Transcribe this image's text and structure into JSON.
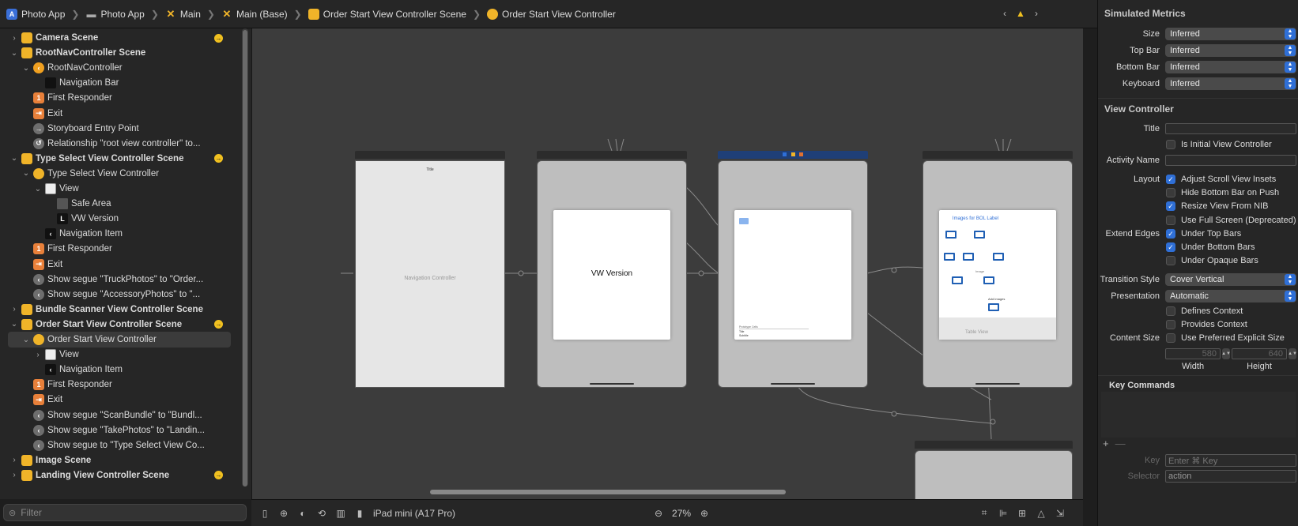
{
  "breadcrumb": [
    {
      "label": "Photo App",
      "icon": "app-blueprint-icon"
    },
    {
      "label": "Photo App",
      "icon": "folder-icon"
    },
    {
      "label": "Main",
      "icon": "storyboard-icon"
    },
    {
      "label": "Main (Base)",
      "icon": "storyboard-icon"
    },
    {
      "label": "Order Start View Controller Scene",
      "icon": "scene-icon"
    },
    {
      "label": "Order Start View Controller",
      "icon": "view-controller-icon"
    }
  ],
  "outline": [
    {
      "label": "Camera Scene",
      "bold": true,
      "indent": 0,
      "disclosure": "right",
      "icon": "scene",
      "badge": true
    },
    {
      "label": "RootNavController Scene",
      "bold": true,
      "indent": 0,
      "disclosure": "down",
      "icon": "scene",
      "badge": false
    },
    {
      "label": "RootNavController",
      "bold": false,
      "indent": 1,
      "disclosure": "down",
      "icon": "navcontroller",
      "badge": false
    },
    {
      "label": "Navigation Bar",
      "bold": false,
      "indent": 2,
      "disclosure": "",
      "icon": "navbar",
      "badge": false
    },
    {
      "label": "First Responder",
      "bold": false,
      "indent": 1,
      "disclosure": "",
      "icon": "responder",
      "badge": false
    },
    {
      "label": "Exit",
      "bold": false,
      "indent": 1,
      "disclosure": "",
      "icon": "exit",
      "badge": false
    },
    {
      "label": "Storyboard Entry Point",
      "bold": false,
      "indent": 1,
      "disclosure": "",
      "icon": "entry",
      "badge": false
    },
    {
      "label": "Relationship \"root view controller\" to...",
      "bold": false,
      "indent": 1,
      "disclosure": "",
      "icon": "relationship",
      "badge": false
    },
    {
      "label": "Type Select View Controller Scene",
      "bold": true,
      "indent": 0,
      "disclosure": "down",
      "icon": "scene",
      "badge": true
    },
    {
      "label": "Type Select View Controller",
      "bold": false,
      "indent": 1,
      "disclosure": "down",
      "icon": "viewcontroller",
      "badge": false
    },
    {
      "label": "View",
      "bold": false,
      "indent": 2,
      "disclosure": "down",
      "icon": "view",
      "badge": false
    },
    {
      "label": "Safe Area",
      "bold": false,
      "indent": 3,
      "disclosure": "",
      "icon": "safearea",
      "badge": false
    },
    {
      "label": "VW Version",
      "bold": false,
      "indent": 3,
      "disclosure": "",
      "icon": "label",
      "badge": false
    },
    {
      "label": "Navigation Item",
      "bold": false,
      "indent": 2,
      "disclosure": "",
      "icon": "navitem",
      "badge": false
    },
    {
      "label": "First Responder",
      "bold": false,
      "indent": 1,
      "disclosure": "",
      "icon": "responder",
      "badge": false
    },
    {
      "label": "Exit",
      "bold": false,
      "indent": 1,
      "disclosure": "",
      "icon": "exit",
      "badge": false
    },
    {
      "label": "Show segue \"TruckPhotos\" to \"Order...",
      "bold": false,
      "indent": 1,
      "disclosure": "",
      "icon": "segue",
      "badge": false
    },
    {
      "label": "Show segue \"AccessoryPhotos\" to \"...",
      "bold": false,
      "indent": 1,
      "disclosure": "",
      "icon": "segue",
      "badge": false
    },
    {
      "label": "Bundle Scanner View Controller Scene",
      "bold": true,
      "indent": 0,
      "disclosure": "right",
      "icon": "scene",
      "badge": false
    },
    {
      "label": "Order Start View Controller Scene",
      "bold": true,
      "indent": 0,
      "disclosure": "down",
      "icon": "scene",
      "badge": true
    },
    {
      "label": "Order Start View Controller",
      "bold": false,
      "indent": 1,
      "disclosure": "down",
      "icon": "viewcontroller",
      "badge": false,
      "selected": true
    },
    {
      "label": "View",
      "bold": false,
      "indent": 2,
      "disclosure": "right",
      "icon": "view",
      "badge": false
    },
    {
      "label": "Navigation Item",
      "bold": false,
      "indent": 2,
      "disclosure": "",
      "icon": "navitem",
      "badge": false
    },
    {
      "label": "First Responder",
      "bold": false,
      "indent": 1,
      "disclosure": "",
      "icon": "responder",
      "badge": false
    },
    {
      "label": "Exit",
      "bold": false,
      "indent": 1,
      "disclosure": "",
      "icon": "exit",
      "badge": false
    },
    {
      "label": "Show segue \"ScanBundle\" to \"Bundl...",
      "bold": false,
      "indent": 1,
      "disclosure": "",
      "icon": "segue",
      "badge": false
    },
    {
      "label": "Show segue \"TakePhotos\" to \"Landin...",
      "bold": false,
      "indent": 1,
      "disclosure": "",
      "icon": "segue",
      "badge": false
    },
    {
      "label": "Show segue to \"Type Select View Co...",
      "bold": false,
      "indent": 1,
      "disclosure": "",
      "icon": "segue",
      "badge": false
    },
    {
      "label": "Image Scene",
      "bold": true,
      "indent": 0,
      "disclosure": "right",
      "icon": "scene",
      "badge": false
    },
    {
      "label": "Landing View Controller Scene",
      "bold": true,
      "indent": 0,
      "disclosure": "right",
      "icon": "scene",
      "badge": true
    }
  ],
  "filter": {
    "placeholder": "Filter"
  },
  "canvas": {
    "nav_title": "Title",
    "nav_placeholder": "Navigation Controller",
    "type_select_label": "VW Version",
    "order_start_cells": "Prototype Cells",
    "order_start_title": "Title",
    "order_start_subtitle": "Subtitle",
    "landing_title": "Images for BOL Label",
    "landing_image": "Image",
    "landing_add_images": "Add Images",
    "landing_table": "Table View"
  },
  "canvas_bar": {
    "device": "iPad mini (A17 Pro)",
    "zoom": "27%"
  },
  "inspector": {
    "simulated_metrics_title": "Simulated Metrics",
    "metrics": [
      {
        "label": "Size",
        "value": "Inferred"
      },
      {
        "label": "Top Bar",
        "value": "Inferred"
      },
      {
        "label": "Bottom Bar",
        "value": "Inferred"
      },
      {
        "label": "Keyboard",
        "value": "Inferred"
      }
    ],
    "vc_title": "View Controller",
    "title_label": "Title",
    "title_value": "",
    "is_initial": "Is Initial View Controller",
    "activity_label": "Activity Name",
    "layout_label": "Layout",
    "layout": [
      {
        "label": "Adjust Scroll View Insets",
        "checked": true
      },
      {
        "label": "Hide Bottom Bar on Push",
        "checked": false
      },
      {
        "label": "Resize View From NIB",
        "checked": true
      },
      {
        "label": "Use Full Screen (Deprecated)",
        "checked": false
      }
    ],
    "extend_label": "Extend Edges",
    "extend": [
      {
        "label": "Under Top Bars",
        "checked": true
      },
      {
        "label": "Under Bottom Bars",
        "checked": true
      },
      {
        "label": "Under Opaque Bars",
        "checked": false
      }
    ],
    "transition_label": "Transition Style",
    "transition_value": "Cover Vertical",
    "presentation_label": "Presentation",
    "presentation_value": "Automatic",
    "defines_context": "Defines Context",
    "provides_context": "Provides Context",
    "content_size_label": "Content Size",
    "use_preferred": "Use Preferred Explicit Size",
    "width_value": "580",
    "height_value": "640",
    "width_label": "Width",
    "height_label": "Height",
    "key_commands": "Key Commands",
    "key_label": "Key",
    "key_placeholder": "Enter ⌘ Key",
    "selector_label": "Selector",
    "selector_placeholder": "action"
  },
  "colors": {
    "accent": "#2f6fd6",
    "scene_icon": "#f0b429",
    "badge": "#f0c020"
  }
}
